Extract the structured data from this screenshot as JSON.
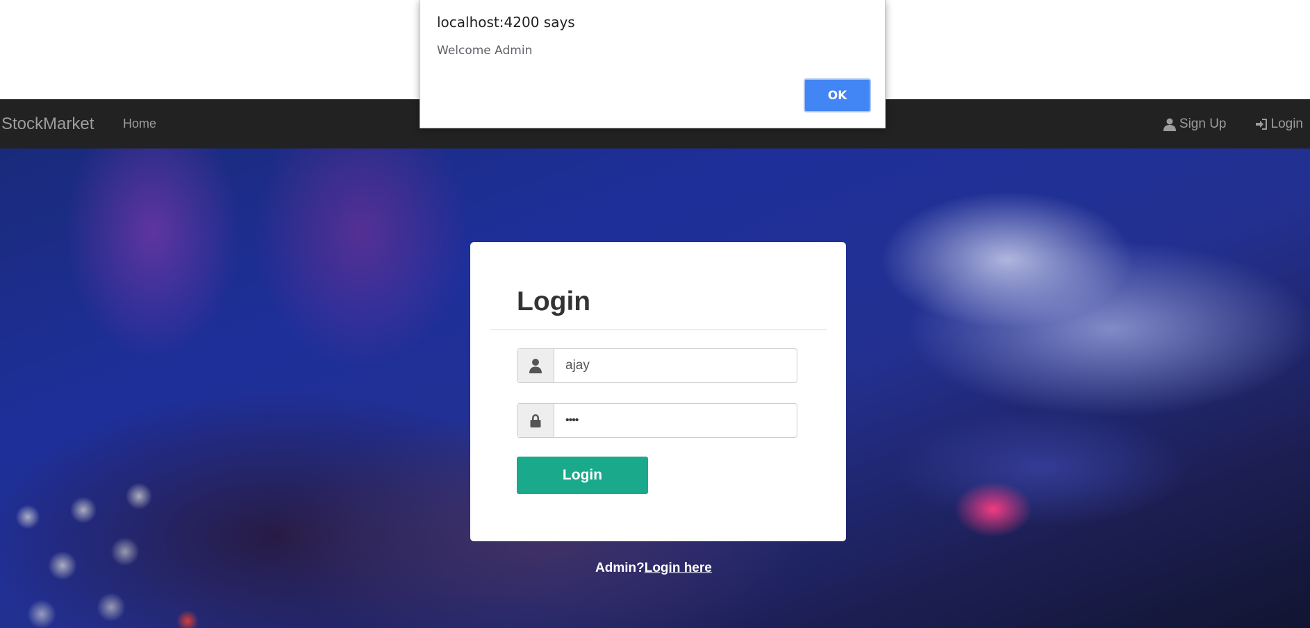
{
  "alert": {
    "title": "localhost:4200 says",
    "message": "Welcome Admin",
    "ok_label": "OK"
  },
  "navbar": {
    "brand": "StockMarket",
    "home": "Home",
    "signup": "Sign Up",
    "login": "Login",
    "signup_icon": "user-icon",
    "login_icon": "login-icon"
  },
  "login_form": {
    "title": "Login",
    "username_value": "ajay",
    "password_masked": "••••",
    "username_icon": "user-icon",
    "password_icon": "lock-icon",
    "submit_label": "Login"
  },
  "admin": {
    "prompt": "Admin?",
    "link": "Login here"
  },
  "colors": {
    "navbar_bg": "#222222",
    "primary_button": "#1aa98b",
    "alert_ok": "#4285f4"
  }
}
